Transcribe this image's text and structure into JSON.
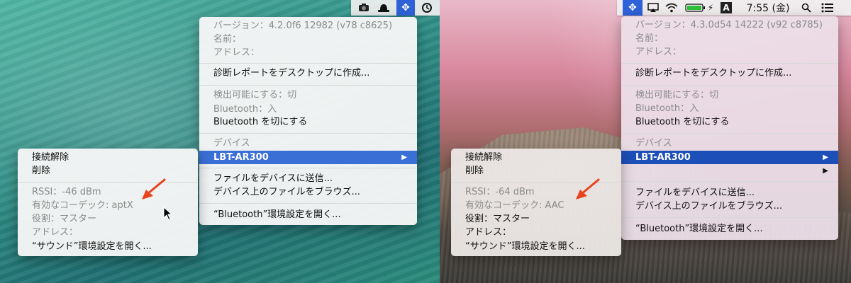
{
  "left": {
    "menubar": {
      "bluetooth_glyph": "✥"
    },
    "main_menu": {
      "version": "バージョン：4.2.0f6 12982 (v78 c8625)",
      "name": "名前：",
      "address": "アドレス：",
      "diagnostics": "診断レポートをデスクトップに作成...",
      "discoverable": "検出可能にする：切",
      "bluetooth_status": "Bluetooth：入",
      "turn_off": "Bluetooth を切にする",
      "devices_header": "デバイス",
      "device_name": "LBT-AR300",
      "submenu_arrow": "▶",
      "send_file": "ファイルをデバイスに送信...",
      "browse_files": "デバイス上のファイルをブラウズ...",
      "open_prefs": "“Bluetooth”環境設定を開く..."
    },
    "submenu": {
      "disconnect": "接続解除",
      "remove": "削除",
      "rssi": "RSSI：-46 dBm",
      "codec": "有効なコーデック: aptX",
      "role": "役割：マスター",
      "address": "アドレス：",
      "open_sound": "“サウンド”環境設定を開く..."
    }
  },
  "right": {
    "menubar": {
      "bluetooth_glyph": "✥",
      "airplay_glyph": "▭",
      "wifi_glyph": "◠",
      "battery_glyph": "⚡",
      "input_method": "A",
      "clock": "7:55 (金)",
      "search_glyph": "⌕",
      "list_glyph": "☰"
    },
    "main_menu": {
      "version": "バージョン：4.3.0d54 14222 (v92 c8785)",
      "name": "名前：",
      "address": "アドレス：",
      "diagnostics": "診断レポートをデスクトップに作成...",
      "discoverable": "検出可能にする：切",
      "bluetooth_status": "Bluetooth：入",
      "turn_off": "Bluetooth を切にする",
      "devices_header": "デバイス",
      "device_name": "LBT-AR300",
      "submenu_arrow": "▶",
      "send_file": "ファイルをデバイスに送信...",
      "browse_files": "デバイス上のファイルをブラウズ...",
      "open_prefs": "“Bluetooth”環境設定を開く..."
    },
    "submenu": {
      "disconnect": "接続解除",
      "remove": "削除",
      "rssi": "RSSI：-64 dBm",
      "codec": "有効なコーデック: AAC",
      "role": "役割：マスター",
      "address": "アドレス：",
      "open_sound": "“サウンド”環境設定を開く..."
    }
  },
  "colors": {
    "selection": "#3a6fd6",
    "annotation_arrow": "#e8431b"
  }
}
